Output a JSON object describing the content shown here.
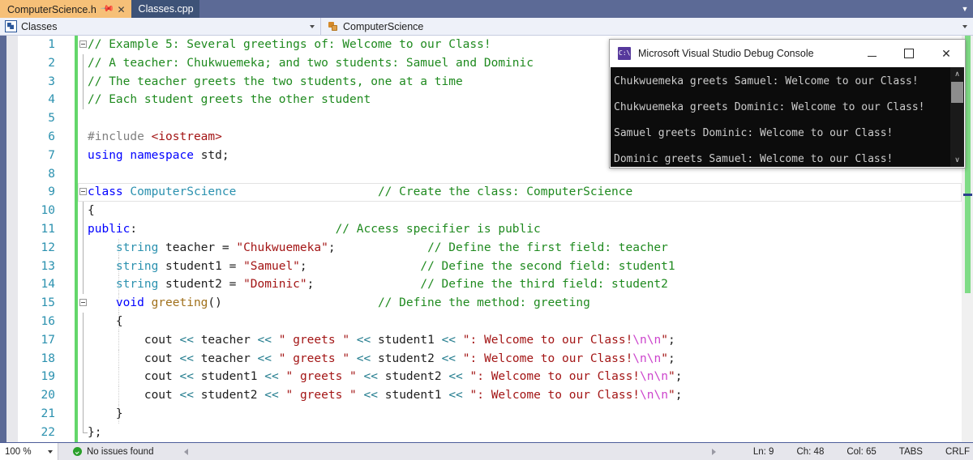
{
  "tabs": [
    {
      "label": "ComputerScience.h",
      "active": true,
      "pin_icon": "pin-icon",
      "close_icon": "close-icon"
    },
    {
      "label": "Classes.cpp",
      "active": false
    }
  ],
  "navbar": {
    "left": {
      "icon": "classes-icon",
      "value": "Classes"
    },
    "right": {
      "icon": "class-symbol-icon",
      "value": "ComputerScience"
    }
  },
  "editor": {
    "lines": [
      {
        "n": "1",
        "fold": true,
        "guide": false,
        "vline": false,
        "current": false,
        "tokens": [
          {
            "t": "// Example 5: Several greetings of: Welcome to our Class!",
            "c": "c-comment"
          }
        ]
      },
      {
        "n": "2",
        "fold": false,
        "guide": false,
        "vline": true,
        "current": false,
        "tokens": [
          {
            "t": "// A teacher: Chukwuemeka; and two students: Samuel and Dominic",
            "c": "c-comment"
          }
        ]
      },
      {
        "n": "3",
        "fold": false,
        "guide": false,
        "vline": true,
        "current": false,
        "tokens": [
          {
            "t": "// The teacher greets the two students, one at a time",
            "c": "c-comment"
          }
        ]
      },
      {
        "n": "4",
        "fold": false,
        "guide": false,
        "vline": true,
        "current": false,
        "tokens": [
          {
            "t": "// Each student greets the other student",
            "c": "c-comment"
          }
        ]
      },
      {
        "n": "5",
        "fold": false,
        "guide": false,
        "vline": false,
        "current": false,
        "tokens": []
      },
      {
        "n": "6",
        "fold": false,
        "guide": false,
        "vline": false,
        "current": false,
        "tokens": [
          {
            "t": "#include ",
            "c": "c-pp"
          },
          {
            "t": "<iostream>",
            "c": "c-str"
          }
        ]
      },
      {
        "n": "7",
        "fold": false,
        "guide": false,
        "vline": false,
        "current": false,
        "tokens": [
          {
            "t": "using namespace ",
            "c": "c-kw"
          },
          {
            "t": "std;",
            "c": "c-plain"
          }
        ]
      },
      {
        "n": "8",
        "fold": false,
        "guide": false,
        "vline": false,
        "current": false,
        "tokens": []
      },
      {
        "n": "9",
        "fold": true,
        "guide": false,
        "vline": false,
        "current": true,
        "tokens": [
          {
            "t": "class ",
            "c": "c-kw"
          },
          {
            "t": "ComputerScience",
            "c": "c-type"
          },
          {
            "t": "                    ",
            "c": "c-plain"
          },
          {
            "t": "// Create the class: ComputerScience",
            "c": "c-comment"
          }
        ]
      },
      {
        "n": "10",
        "fold": false,
        "guide": false,
        "vline": true,
        "current": false,
        "tokens": [
          {
            "t": "{",
            "c": "c-plain"
          }
        ]
      },
      {
        "n": "11",
        "fold": false,
        "guide": false,
        "vline": true,
        "current": false,
        "tokens": [
          {
            "t": "public",
            "c": "c-kw"
          },
          {
            "t": ":",
            "c": "c-plain"
          },
          {
            "t": "                            ",
            "c": "c-plain"
          },
          {
            "t": "// Access specifier is public",
            "c": "c-comment"
          }
        ]
      },
      {
        "n": "12",
        "fold": false,
        "guide": true,
        "vline": true,
        "current": false,
        "tokens": [
          {
            "t": "    ",
            "c": "c-plain"
          },
          {
            "t": "string",
            "c": "c-type"
          },
          {
            "t": " teacher = ",
            "c": "c-plain"
          },
          {
            "t": "\"Chukwuemeka\"",
            "c": "c-str"
          },
          {
            "t": ";",
            "c": "c-plain"
          },
          {
            "t": "             ",
            "c": "c-plain"
          },
          {
            "t": "// Define the first field: teacher",
            "c": "c-comment"
          }
        ]
      },
      {
        "n": "13",
        "fold": false,
        "guide": true,
        "vline": true,
        "current": false,
        "tokens": [
          {
            "t": "    ",
            "c": "c-plain"
          },
          {
            "t": "string",
            "c": "c-type"
          },
          {
            "t": " student1 = ",
            "c": "c-plain"
          },
          {
            "t": "\"Samuel\"",
            "c": "c-str"
          },
          {
            "t": ";",
            "c": "c-plain"
          },
          {
            "t": "                ",
            "c": "c-plain"
          },
          {
            "t": "// Define the second field: student1",
            "c": "c-comment"
          }
        ]
      },
      {
        "n": "14",
        "fold": false,
        "guide": true,
        "vline": true,
        "current": false,
        "tokens": [
          {
            "t": "    ",
            "c": "c-plain"
          },
          {
            "t": "string",
            "c": "c-type"
          },
          {
            "t": " student2 = ",
            "c": "c-plain"
          },
          {
            "t": "\"Dominic\"",
            "c": "c-str"
          },
          {
            "t": ";",
            "c": "c-plain"
          },
          {
            "t": "               ",
            "c": "c-plain"
          },
          {
            "t": "// Define the third field: student2",
            "c": "c-comment"
          }
        ]
      },
      {
        "n": "15",
        "fold": true,
        "guide": true,
        "vline": true,
        "current": false,
        "tokens": [
          {
            "t": "    ",
            "c": "c-plain"
          },
          {
            "t": "void ",
            "c": "c-kw"
          },
          {
            "t": "greeting",
            "c": "c-fn"
          },
          {
            "t": "()",
            "c": "c-plain"
          },
          {
            "t": "                      ",
            "c": "c-plain"
          },
          {
            "t": "// Define the method: greeting",
            "c": "c-comment"
          }
        ]
      },
      {
        "n": "16",
        "fold": false,
        "guide": true,
        "vline": true,
        "current": false,
        "tokens": [
          {
            "t": "    {",
            "c": "c-plain"
          }
        ]
      },
      {
        "n": "17",
        "fold": false,
        "guide": true,
        "vline": true,
        "current": false,
        "tokens": [
          {
            "t": "        cout ",
            "c": "c-plain"
          },
          {
            "t": "<<",
            "c": "c-op"
          },
          {
            "t": " teacher ",
            "c": "c-plain"
          },
          {
            "t": "<<",
            "c": "c-op"
          },
          {
            "t": " ",
            "c": "c-plain"
          },
          {
            "t": "\" greets \"",
            "c": "c-str"
          },
          {
            "t": " ",
            "c": "c-plain"
          },
          {
            "t": "<<",
            "c": "c-op"
          },
          {
            "t": " student1 ",
            "c": "c-plain"
          },
          {
            "t": "<<",
            "c": "c-op"
          },
          {
            "t": " ",
            "c": "c-plain"
          },
          {
            "t": "\": Welcome to our Class!",
            "c": "c-str"
          },
          {
            "t": "\\n\\n",
            "c": "c-esc"
          },
          {
            "t": "\"",
            "c": "c-str"
          },
          {
            "t": ";",
            "c": "c-plain"
          }
        ]
      },
      {
        "n": "18",
        "fold": false,
        "guide": true,
        "vline": true,
        "current": false,
        "tokens": [
          {
            "t": "        cout ",
            "c": "c-plain"
          },
          {
            "t": "<<",
            "c": "c-op"
          },
          {
            "t": " teacher ",
            "c": "c-plain"
          },
          {
            "t": "<<",
            "c": "c-op"
          },
          {
            "t": " ",
            "c": "c-plain"
          },
          {
            "t": "\" greets \"",
            "c": "c-str"
          },
          {
            "t": " ",
            "c": "c-plain"
          },
          {
            "t": "<<",
            "c": "c-op"
          },
          {
            "t": " student2 ",
            "c": "c-plain"
          },
          {
            "t": "<<",
            "c": "c-op"
          },
          {
            "t": " ",
            "c": "c-plain"
          },
          {
            "t": "\": Welcome to our Class!",
            "c": "c-str"
          },
          {
            "t": "\\n\\n",
            "c": "c-esc"
          },
          {
            "t": "\"",
            "c": "c-str"
          },
          {
            "t": ";",
            "c": "c-plain"
          }
        ]
      },
      {
        "n": "19",
        "fold": false,
        "guide": true,
        "vline": true,
        "current": false,
        "tokens": [
          {
            "t": "        cout ",
            "c": "c-plain"
          },
          {
            "t": "<<",
            "c": "c-op"
          },
          {
            "t": " student1 ",
            "c": "c-plain"
          },
          {
            "t": "<<",
            "c": "c-op"
          },
          {
            "t": " ",
            "c": "c-plain"
          },
          {
            "t": "\" greets \"",
            "c": "c-str"
          },
          {
            "t": " ",
            "c": "c-plain"
          },
          {
            "t": "<<",
            "c": "c-op"
          },
          {
            "t": " student2 ",
            "c": "c-plain"
          },
          {
            "t": "<<",
            "c": "c-op"
          },
          {
            "t": " ",
            "c": "c-plain"
          },
          {
            "t": "\": Welcome to our Class!",
            "c": "c-str"
          },
          {
            "t": "\\n\\n",
            "c": "c-esc"
          },
          {
            "t": "\"",
            "c": "c-str"
          },
          {
            "t": ";",
            "c": "c-plain"
          }
        ]
      },
      {
        "n": "20",
        "fold": false,
        "guide": true,
        "vline": true,
        "current": false,
        "tokens": [
          {
            "t": "        cout ",
            "c": "c-plain"
          },
          {
            "t": "<<",
            "c": "c-op"
          },
          {
            "t": " student2 ",
            "c": "c-plain"
          },
          {
            "t": "<<",
            "c": "c-op"
          },
          {
            "t": " ",
            "c": "c-plain"
          },
          {
            "t": "\" greets \"",
            "c": "c-str"
          },
          {
            "t": " ",
            "c": "c-plain"
          },
          {
            "t": "<<",
            "c": "c-op"
          },
          {
            "t": " student1 ",
            "c": "c-plain"
          },
          {
            "t": "<<",
            "c": "c-op"
          },
          {
            "t": " ",
            "c": "c-plain"
          },
          {
            "t": "\": Welcome to our Class!",
            "c": "c-str"
          },
          {
            "t": "\\n\\n",
            "c": "c-esc"
          },
          {
            "t": "\"",
            "c": "c-str"
          },
          {
            "t": ";",
            "c": "c-plain"
          }
        ]
      },
      {
        "n": "21",
        "fold": false,
        "guide": true,
        "vline": true,
        "current": false,
        "tokens": [
          {
            "t": "    }",
            "c": "c-plain"
          }
        ]
      },
      {
        "n": "22",
        "fold": false,
        "guide": false,
        "vline": true,
        "vline_end": true,
        "current": false,
        "tokens": [
          {
            "t": "};",
            "c": "c-plain"
          }
        ]
      }
    ]
  },
  "console": {
    "icon": "cmd-icon",
    "title": "Microsoft Visual Studio Debug Console",
    "minimize_label": "Minimize",
    "maximize_label": "Maximize",
    "close_label": "✕",
    "lines": [
      "Chukwuemeka greets Samuel: Welcome to our Class!",
      "Chukwuemeka greets Dominic: Welcome to our Class!",
      "Samuel greets Dominic: Welcome to our Class!",
      "Dominic greets Samuel: Welcome to our Class!"
    ],
    "scroll_up": "∧",
    "scroll_down": "∨"
  },
  "statusbar": {
    "zoom": "100 %",
    "issues_icon": "success-check-icon",
    "issues": "No issues found",
    "ln": "Ln: 9",
    "ch": "Ch: 48",
    "col": "Col: 65",
    "tabs": "TABS",
    "crlf": "CRLF"
  },
  "colors": {
    "tab_active_bg": "#f6c078",
    "tab_inactive_bg": "#3d5277",
    "tabstrip_bg": "#5c6a96",
    "comment": "#1f8a1f",
    "keyword": "#0000ff",
    "type": "#2b91af",
    "string": "#a31515",
    "escape": "#cc44cc",
    "operator": "#1f7a8c",
    "function": "#a0701b",
    "preprocessor": "#808080",
    "linenumber": "#2b91af",
    "changebar": "#63d66a",
    "console_bg": "#0c0c0c",
    "console_fg": "#cccccc",
    "statusbar_bg": "#e6e6ec"
  }
}
